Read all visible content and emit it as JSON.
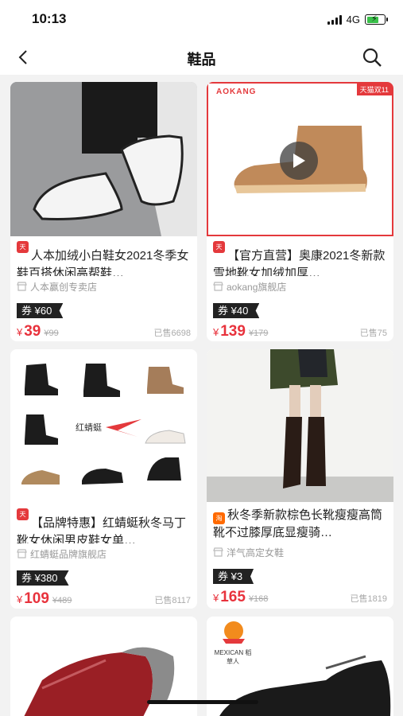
{
  "status": {
    "time": "10:13",
    "network": "4G"
  },
  "nav": {
    "title": "鞋品"
  },
  "products": [
    {
      "title": "人本加绒小白鞋女2021冬季女鞋百搭休闲高帮鞋…",
      "platform": "天猫",
      "shop": "人本赢创专卖店",
      "coupon": "券 ¥60",
      "price_symbol": "¥",
      "price": "39",
      "original_price": "¥99",
      "sold": "已售6698"
    },
    {
      "title": "【官方直营】奥康2021冬新款雪地靴女加绒加厚…",
      "platform": "天猫",
      "shop": "aokang旗舰店",
      "coupon": "券 ¥40",
      "price_symbol": "¥",
      "price": "139",
      "original_price": "¥179",
      "sold": "已售75",
      "brand": "AOKANG",
      "tag": "天猫双11"
    },
    {
      "title": "【品牌特惠】红蜻蜓秋冬马丁靴女休闲男皮鞋女单…",
      "platform": "天猫",
      "shop": "红蜻蜓品牌旗舰店",
      "coupon": "券 ¥380",
      "price_symbol": "¥",
      "price": "109",
      "original_price": "¥489",
      "sold": "已售8117",
      "brand": "红蜻蜓"
    },
    {
      "title": "秋冬季新款棕色长靴瘦瘦高筒靴不过膝厚底显瘦骑…",
      "platform": "淘",
      "shop": "洋气高定女鞋",
      "coupon": "券 ¥3",
      "price_symbol": "¥",
      "price": "165",
      "original_price": "¥168",
      "sold": "已售1819"
    },
    {
      "brand": ""
    },
    {
      "brand": "MEXICAN 稻草人"
    }
  ],
  "colors": {
    "accent": "#e8323c",
    "tmall": "#e4393c",
    "taobao": "#ff6a00",
    "coupon_bg": "#222222"
  }
}
